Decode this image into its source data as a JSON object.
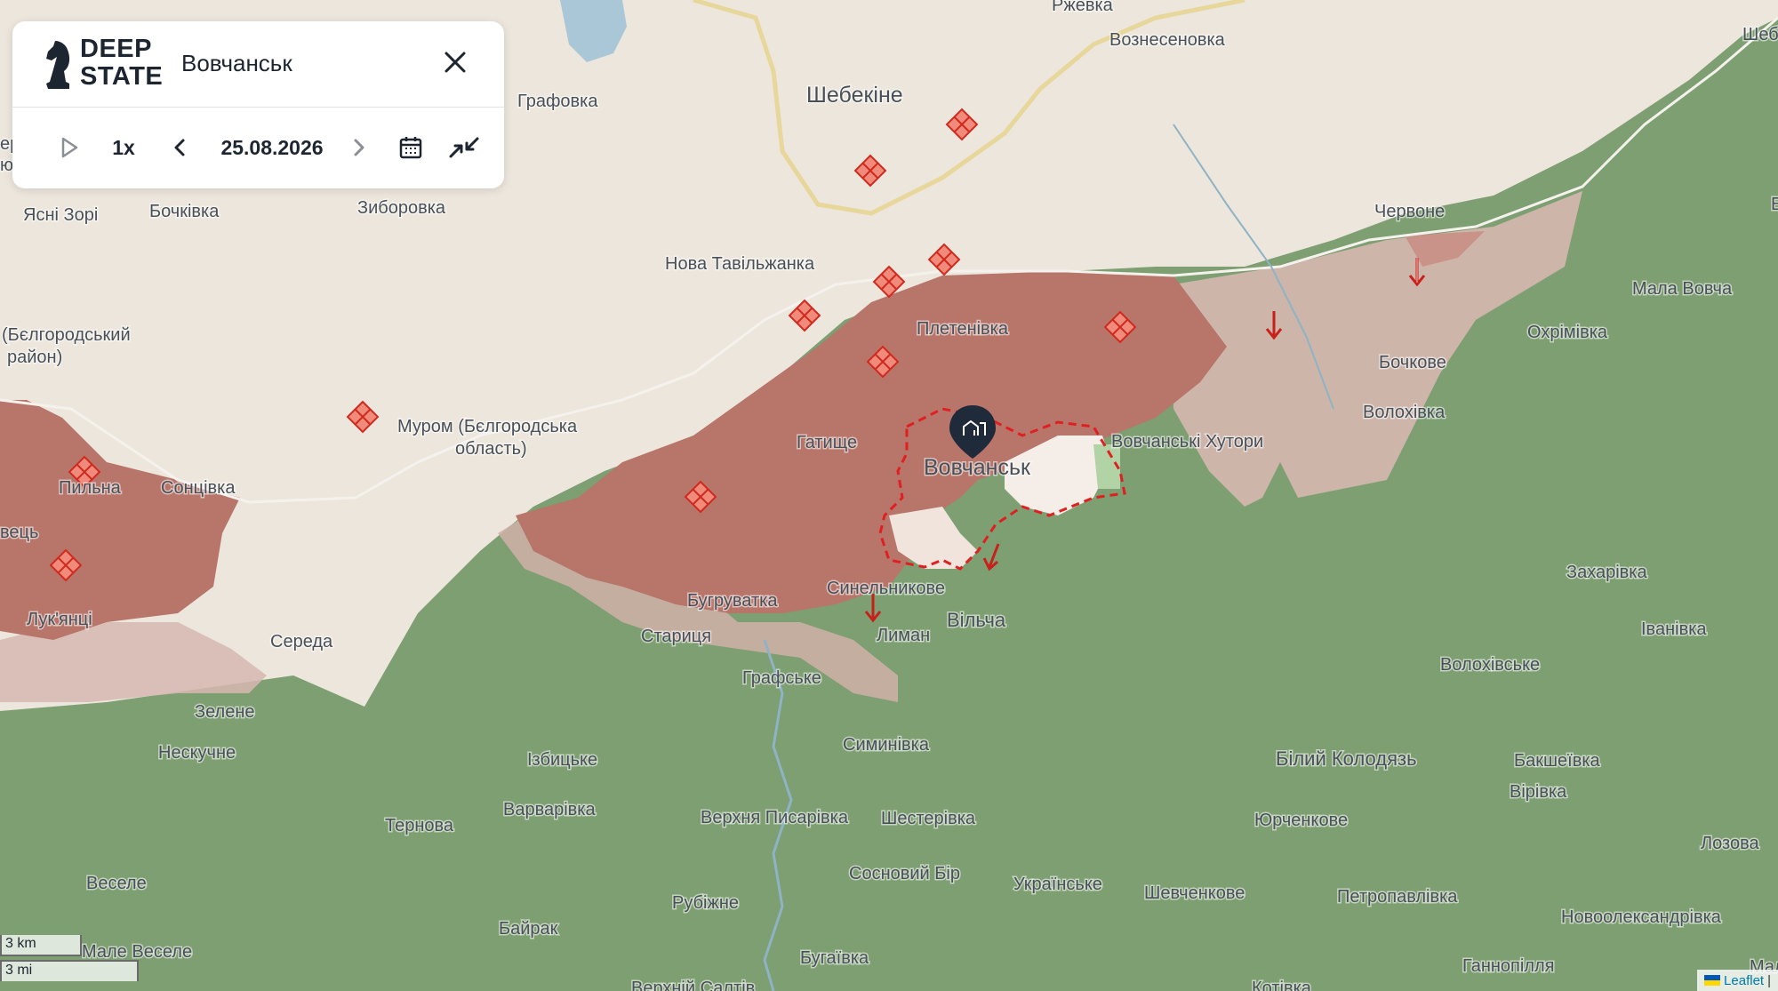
{
  "app": {
    "logo_line1": "DEEP",
    "logo_line2": "STATE",
    "title": "Вовчанськ"
  },
  "playback": {
    "speed": "1x",
    "date": "25.08.2026"
  },
  "map": {
    "selected_city": "Вовчанськ",
    "labels": {
      "rzhevka": "Ржевка",
      "voznesenovka": "Вознесеновка",
      "shebe": "Шебе",
      "shebekine": "Шебекіне",
      "grafovka": "Графовка",
      "yasni_zori": "Ясні Зорі",
      "bochkivka": "Бочківка",
      "zyborovka": "Зиборовка",
      "nova_tavilzhanka": "Нова Тавільжанка",
      "chervone": "Червоне",
      "belgorod_rayon_1": "(Бєлгородський",
      "belgorod_rayon_2": "район)",
      "pletenivka": "Плетенівка",
      "mala_vovcha": "Мала Вовча",
      "okhrimivka": "Охрімівка",
      "bochkove": "Бочкове",
      "murom_1": "Муром (Бєлгородська",
      "murom_2": "область)",
      "hatyshche": "Гатище",
      "volokhivka": "Волохівка",
      "vovchanski_khutory": "Вовчанські Хутори",
      "vovchansk": "Вовчанськ",
      "pylna": "Пильна",
      "sontsivka": "Сонцівка",
      "vets": "вець",
      "lukyantsi": "Лук'янці",
      "sereda": "Середа",
      "buhruvatka": "Бугруватка",
      "synelnykove": "Синельникове",
      "vilcha": "Вільча",
      "staryts_ia": "Стариця",
      "lyman": "Лиман",
      "zakharivka": "Захарівка",
      "ivanivka": "Іванівка",
      "volokhivske": "Волохівське",
      "grafske": "Графське",
      "zelene": "Зелене",
      "neskuchne": "Нескучне",
      "izbytske": "Ізбицьке",
      "syminivka": "Симинівка",
      "bilyi_kolodiaz": "Білий Колодязь",
      "bakshеivka": "Бакшеївка",
      "virivka": "Вірівка",
      "ternova": "Тернова",
      "varvarivka": "Варварівка",
      "verkhnia_pysarivka": "Верхня Писарівка",
      "shesterivka": "Шестерівка",
      "yurchenkove": "Юрченкове",
      "lozova": "Лозова",
      "vesele": "Веселе",
      "sosnovyi_bir": "Сосновий Бір",
      "ukrainske": "Українське",
      "shevchenkove": "Шевченкове",
      "petropavlivka": "Петропавлівка",
      "novooleksandrivka": "Новоолександрівка",
      "rubizhne": "Рубіжне",
      "bairak": "Байрак",
      "male_vesele": "Мале Веселе",
      "buhaivka": "Бугаївка",
      "hannopillia": "Ганнопілля",
      "verkhnii_saltiv": "Верхній Салтів",
      "kotivka": "Котівка",
      "mal": "Мал",
      "edge_left_1": "ер",
      "edge_left_2": "ю,",
      "edge_right": "Е"
    }
  },
  "scale": {
    "km": "3 km",
    "mi": "3 mi"
  },
  "attribution": {
    "text": "Leaflet",
    "separator": "|"
  },
  "colors": {
    "occupied": "#b86c5f",
    "contested": "#c99e96",
    "ukraine_control": "#7aa070",
    "russia_territory": "#ece6dc",
    "city_outline": "#e02020",
    "marker": "#1f2a3a"
  },
  "icons": {
    "logo": "knight-chess-icon",
    "play": "play-icon",
    "prev": "chevron-left-icon",
    "next": "chevron-right-icon",
    "calendar": "calendar-icon",
    "collapse": "collapse-arrows-icon",
    "close": "close-icon",
    "city_marker": "city-marker-icon",
    "hit": "strike-marker-icon",
    "attack": "attack-arrow-icon"
  }
}
